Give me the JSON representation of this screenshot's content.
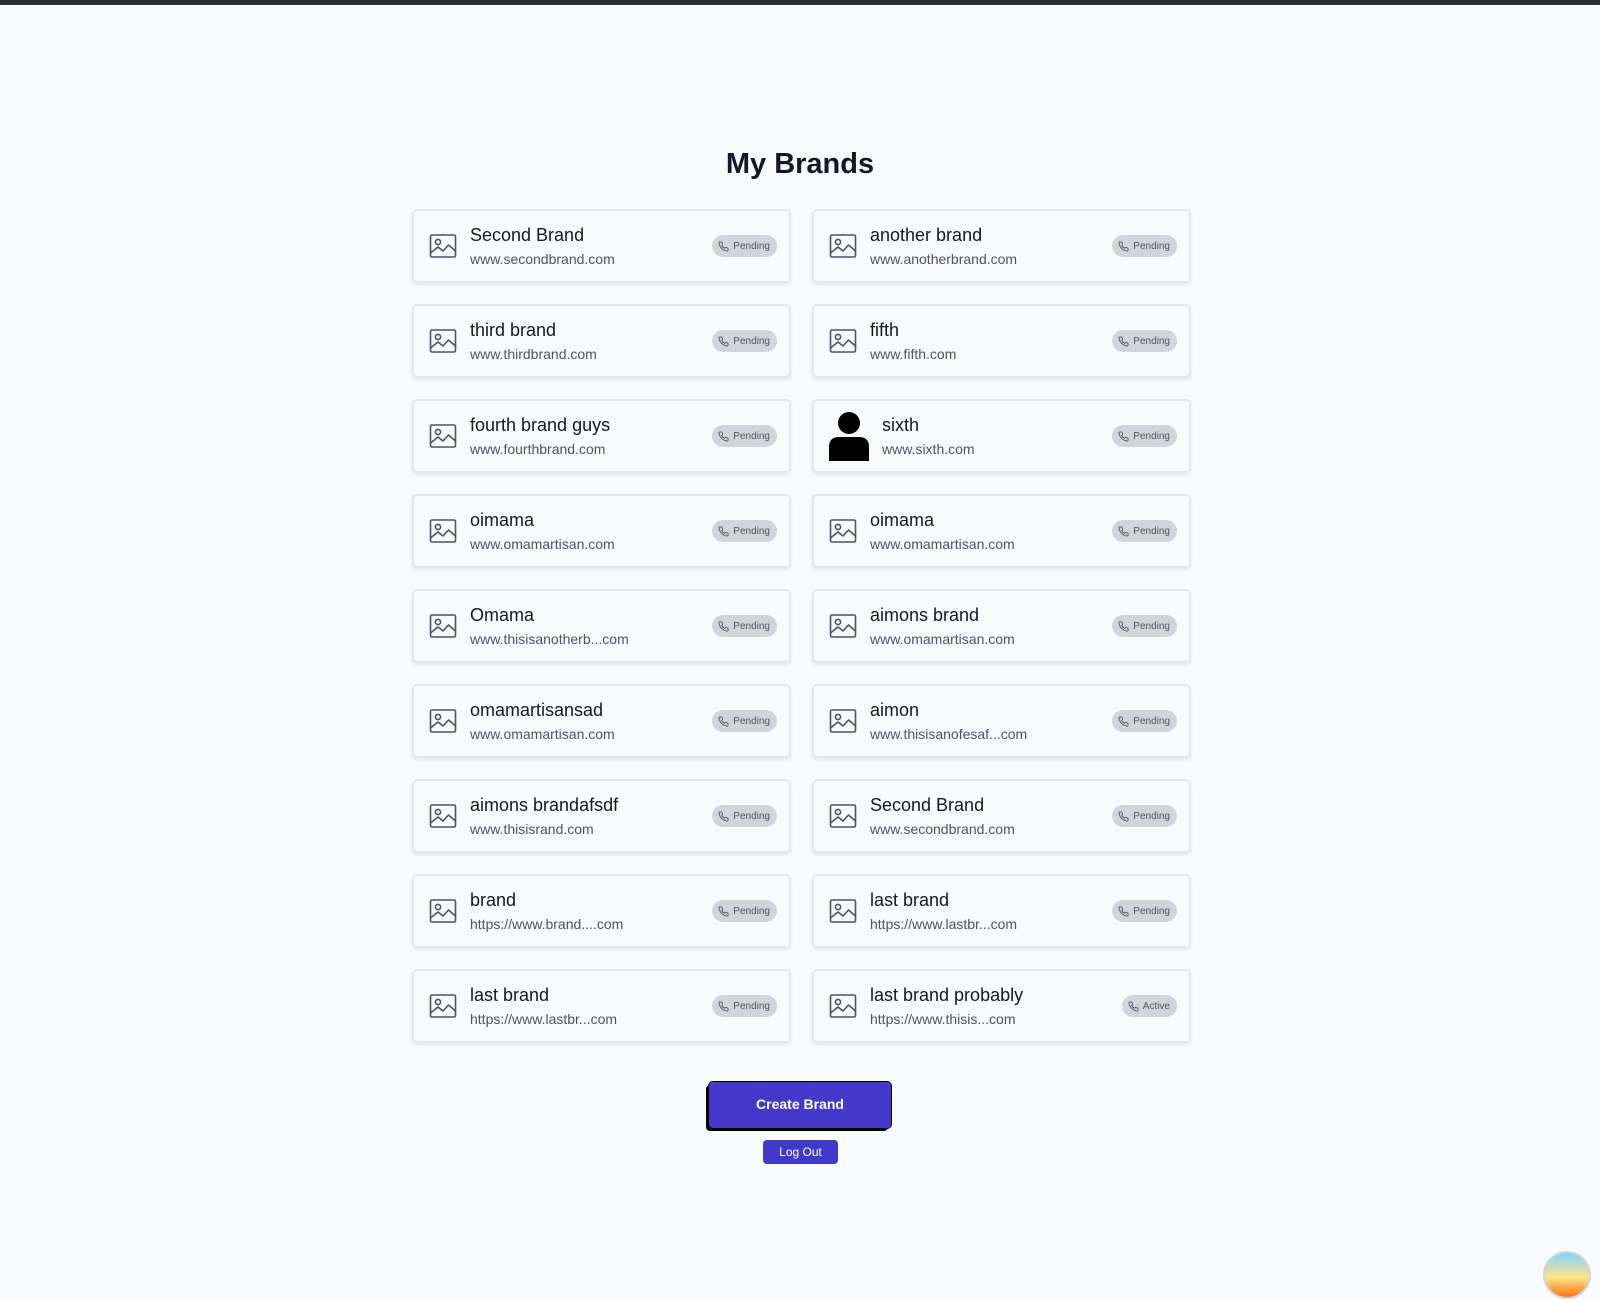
{
  "page": {
    "title": "My Brands"
  },
  "brands": [
    {
      "name": "Second Brand",
      "url": "www.secondbrand.com",
      "status": "Pending",
      "icon": "image-placeholder-icon"
    },
    {
      "name": "another brand",
      "url": "www.anotherbrand.com",
      "status": "Pending",
      "icon": "image-placeholder-icon"
    },
    {
      "name": "third brand",
      "url": "www.thirdbrand.com",
      "status": "Pending",
      "icon": "image-placeholder-icon"
    },
    {
      "name": "fifth",
      "url": "www.fifth.com",
      "status": "Pending",
      "icon": "image-placeholder-icon"
    },
    {
      "name": "fourth brand guys",
      "url": "www.fourthbrand.com",
      "status": "Pending",
      "icon": "image-placeholder-icon"
    },
    {
      "name": "sixth",
      "url": "www.sixth.com",
      "status": "Pending",
      "icon": "person-icon"
    },
    {
      "name": "oimama",
      "url": "www.omamartisan.com",
      "status": "Pending",
      "icon": "image-placeholder-icon"
    },
    {
      "name": "oimama",
      "url": "www.omamartisan.com",
      "status": "Pending",
      "icon": "image-placeholder-icon"
    },
    {
      "name": "Omama",
      "url": "www.thisisanotherb...com",
      "status": "Pending",
      "icon": "image-placeholder-icon"
    },
    {
      "name": "aimons brand",
      "url": "www.omamartisan.com",
      "status": "Pending",
      "icon": "image-placeholder-icon"
    },
    {
      "name": "omamartisansad",
      "url": "www.omamartisan.com",
      "status": "Pending",
      "icon": "image-placeholder-icon"
    },
    {
      "name": "aimon",
      "url": "www.thisisanofesaf...com",
      "status": "Pending",
      "icon": "image-placeholder-icon"
    },
    {
      "name": "aimons brandafsdf",
      "url": "www.thisisrand.com",
      "status": "Pending",
      "icon": "image-placeholder-icon"
    },
    {
      "name": "Second Brand",
      "url": "www.secondbrand.com",
      "status": "Pending",
      "icon": "image-placeholder-icon"
    },
    {
      "name": "brand",
      "url": "https://www.brand....com",
      "status": "Pending",
      "icon": "image-placeholder-icon"
    },
    {
      "name": "last brand",
      "url": "https://www.lastbr...com",
      "status": "Pending",
      "icon": "image-placeholder-icon"
    },
    {
      "name": "last brand",
      "url": "https://www.lastbr...com",
      "status": "Pending",
      "icon": "image-placeholder-icon"
    },
    {
      "name": "last brand probably",
      "url": "https://www.thisis...com",
      "status": "Active",
      "icon": "image-placeholder-icon"
    }
  ],
  "actions": {
    "create_label": "Create Brand",
    "logout_label": "Log Out"
  },
  "colors": {
    "primary": "#4338ca",
    "badge_bg": "#d1d5db",
    "page_bg": "#f8fafc"
  }
}
